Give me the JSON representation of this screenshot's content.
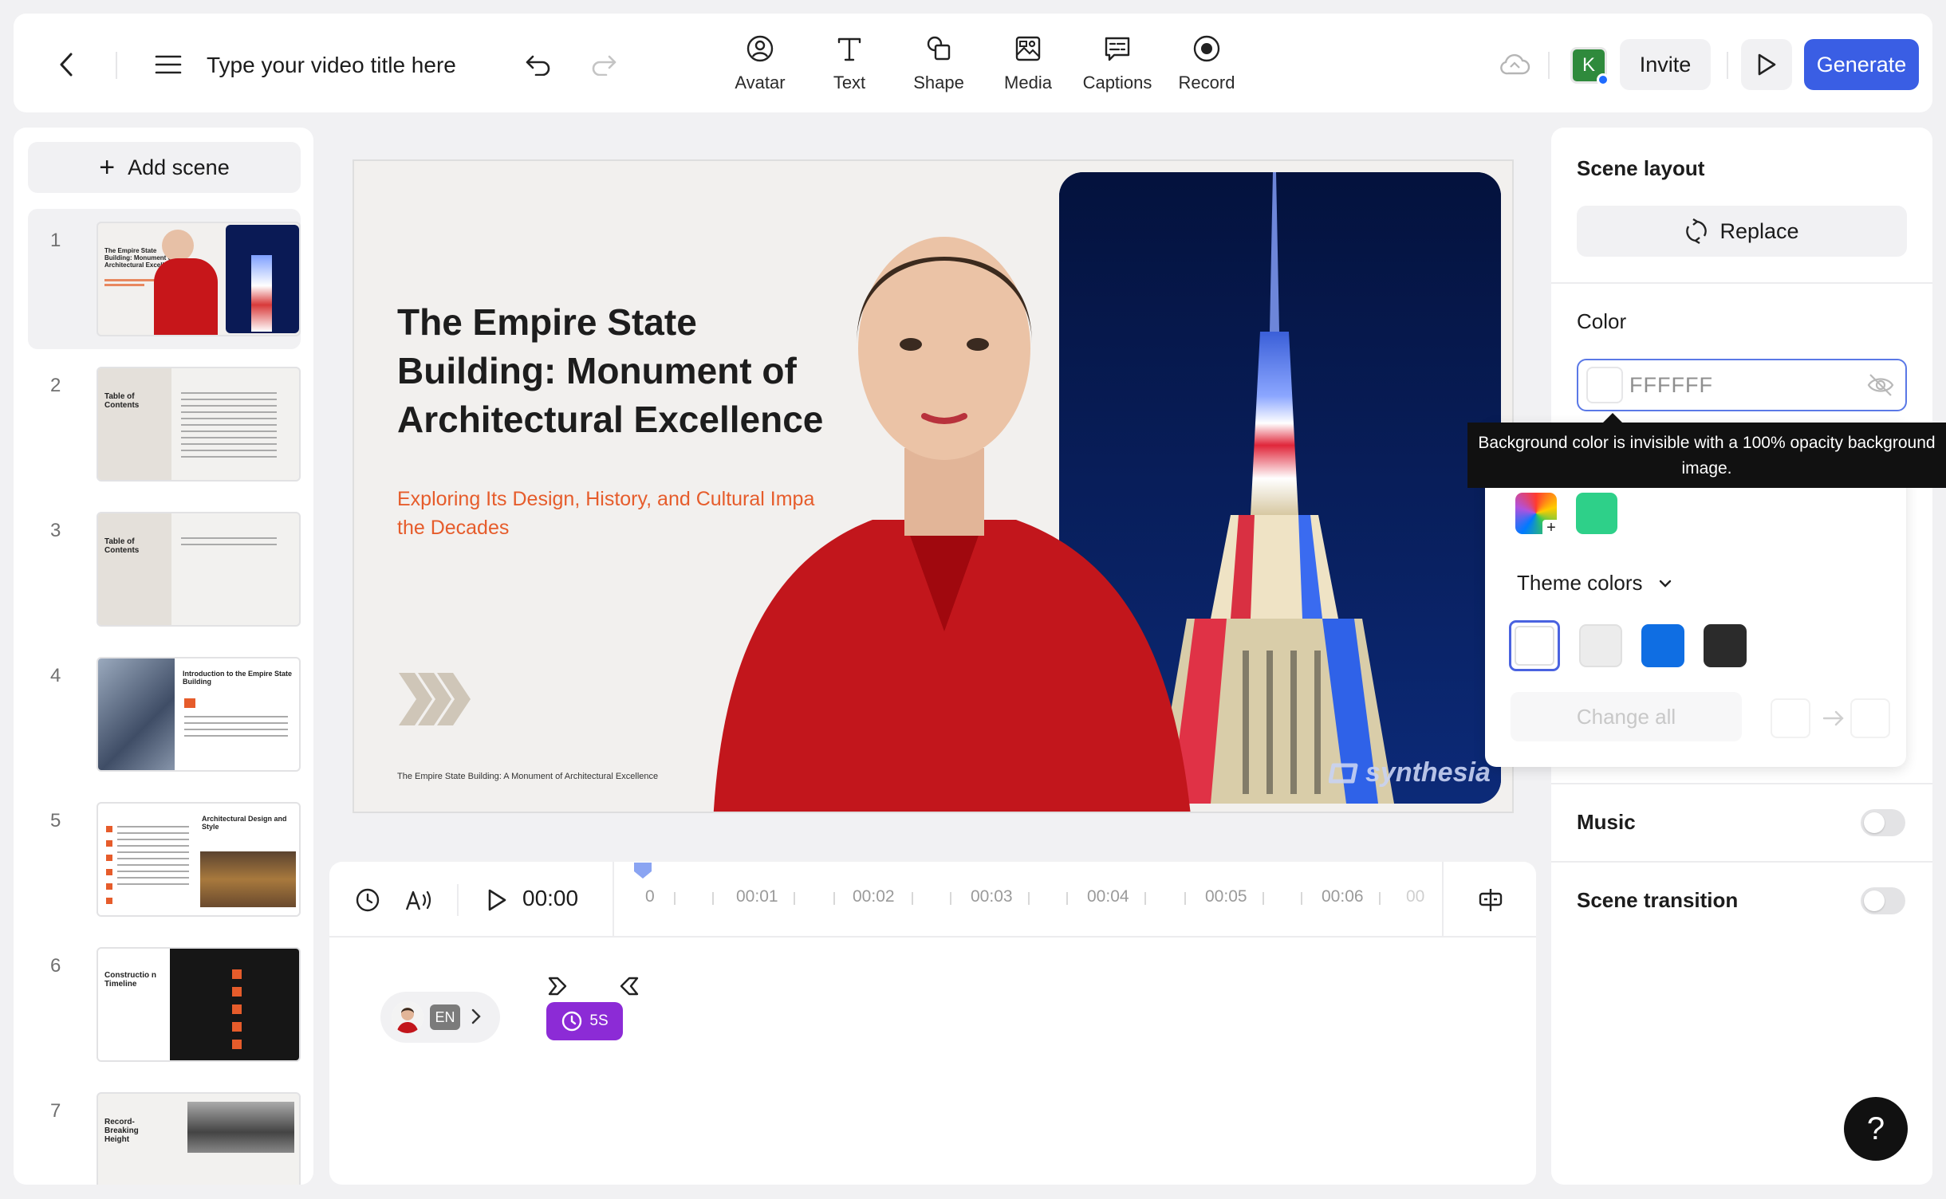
{
  "header": {
    "video_title_placeholder": "Type your video title here",
    "tools": [
      {
        "label": "Avatar",
        "icon": "avatar-icon"
      },
      {
        "label": "Text",
        "icon": "text-icon"
      },
      {
        "label": "Shape",
        "icon": "shape-icon"
      },
      {
        "label": "Media",
        "icon": "media-icon"
      },
      {
        "label": "Captions",
        "icon": "captions-icon"
      },
      {
        "label": "Record",
        "icon": "record-icon"
      }
    ],
    "user_initial": "K",
    "invite_label": "Invite",
    "generate_label": "Generate",
    "colors": {
      "generate": "#3a5ee4",
      "user_avatar": "#2f8a3c"
    }
  },
  "scenes": {
    "add_label": "Add scene",
    "items": [
      {
        "number": "1",
        "title": "The Empire State Building: Monument of Architectural Excellence"
      },
      {
        "number": "2",
        "title": "Table of Contents"
      },
      {
        "number": "3",
        "title": "Table of Contents"
      },
      {
        "number": "4",
        "title": "Introduction to the Empire State Building"
      },
      {
        "number": "5",
        "title": "Architectural Design and Style"
      },
      {
        "number": "6",
        "title": "Constructio n Timeline"
      },
      {
        "number": "7",
        "title": "Record-Breaking Height"
      }
    ]
  },
  "slide": {
    "title": "The Empire State Building: Monument of Architectural Excellence",
    "subtitle": "Exploring Its Design, History, and Cultural Impa the Decades",
    "footer": "The Empire State Building: A Monument of Architectural Excellence",
    "watermark": "synthesia",
    "accent_color": "#e65c2b"
  },
  "timeline": {
    "current_time": "00:00",
    "ticks": [
      "0",
      "00:01",
      "00:02",
      "00:03",
      "00:04",
      "00:05",
      "00:06",
      "00"
    ],
    "language": "EN",
    "pause_label": "5S",
    "pause_color": "#8c2bd6"
  },
  "right_panel": {
    "scene_layout_label": "Scene layout",
    "replace_label": "Replace",
    "color_label": "Color",
    "color_value": "FFFFFF",
    "tooltip": "Background color is invisible with a 100% opacity background image.",
    "theme_colors_label": "Theme colors",
    "other_colors": [
      "#2ed089"
    ],
    "theme_colors": [
      "#ffffff",
      "#ececec",
      "#0f6ee3",
      "#2b2b2b"
    ],
    "change_all_label": "Change all",
    "music_label": "Music",
    "scene_transition_label": "Scene transition"
  },
  "help_label": "?"
}
